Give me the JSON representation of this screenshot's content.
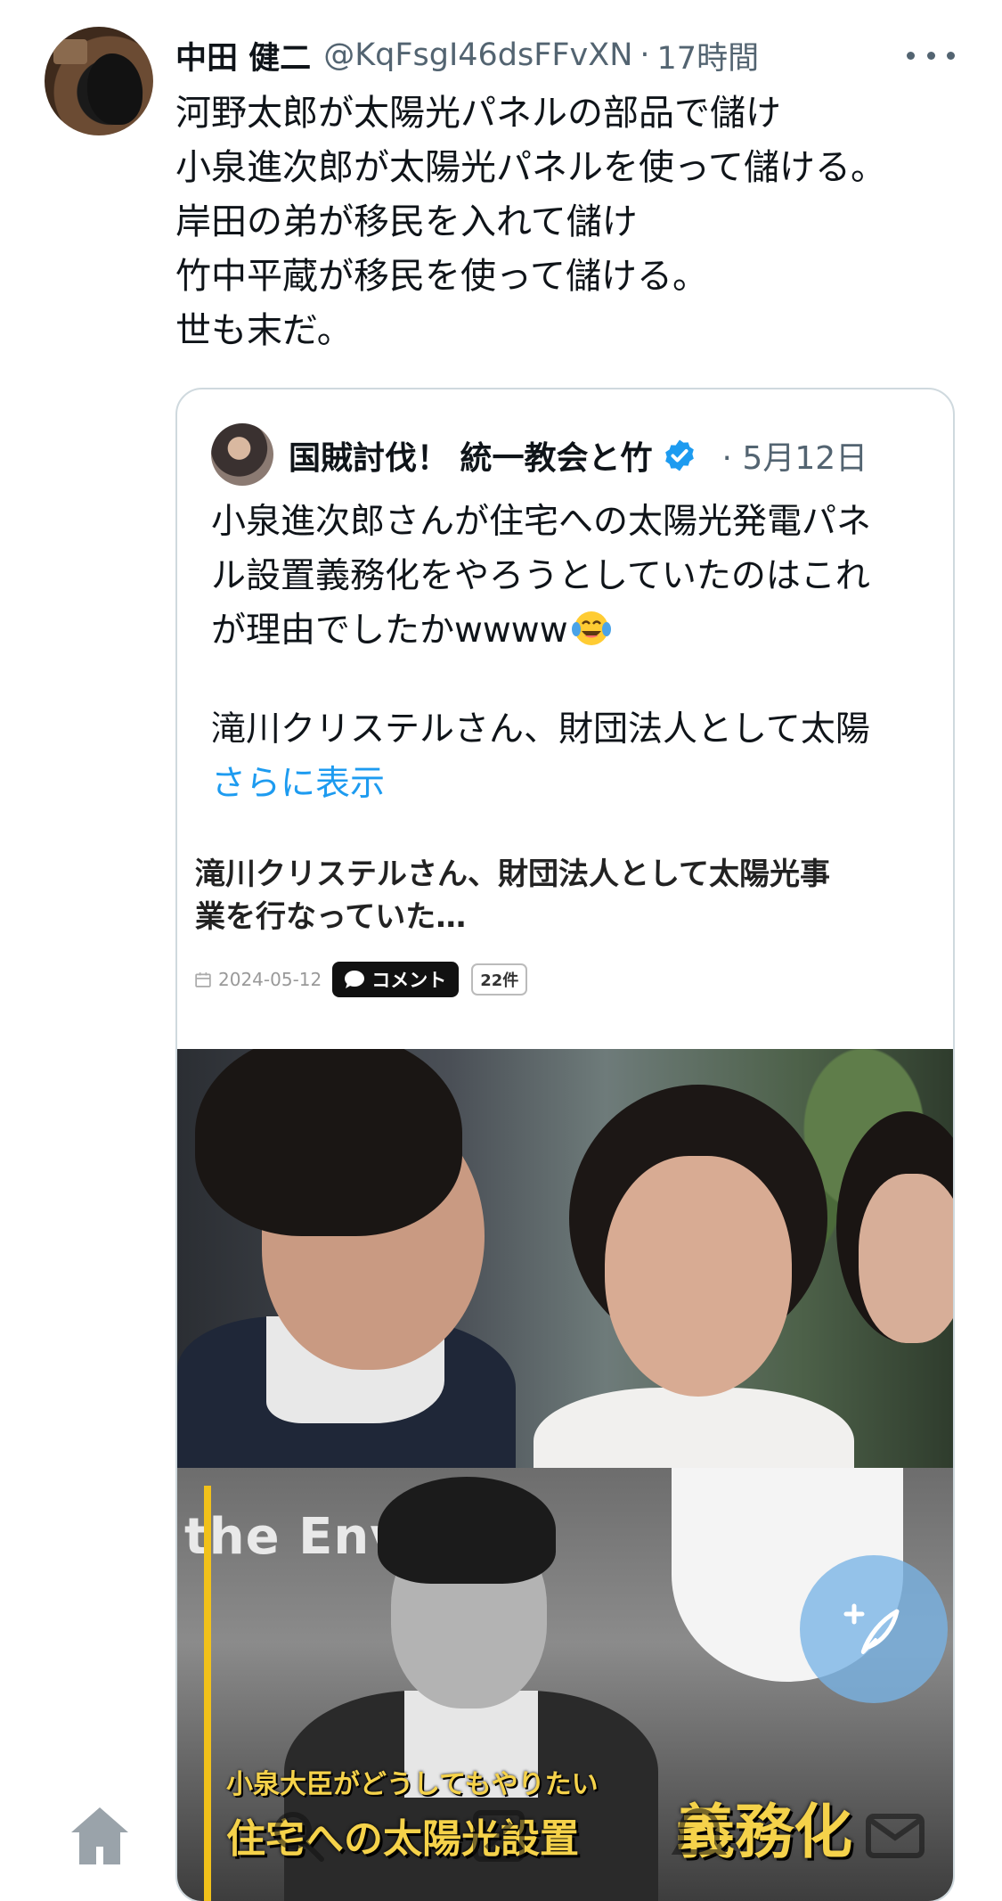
{
  "author": {
    "name": "中田 健二",
    "handle": "@KqFsgI46dsFFvXN",
    "separator": "·",
    "time": "17時間"
  },
  "tweet_lines": [
    "河野太郎が太陽光パネルの部品で儲け",
    "小泉進次郎が太陽光パネルを使って儲ける。",
    "岸田の弟が移民を入れて儲け",
    "竹中平蔵が移民を使って儲ける。",
    "世も末だ。"
  ],
  "quote": {
    "name": "国賊討伐！ 統一教会と竹",
    "time": "· 5月12日",
    "text_lines": [
      "小泉進次郎さんが住宅への太陽光発電パネ",
      "ル設置義務化をやろうとしていたのはこれ",
      "が理由でしたかwwww"
    ],
    "text_line4": "滝川クリステルさん、財団法人として太陽",
    "show_more": "さらに表示",
    "article": {
      "title_lines": [
        "滝川クリステルさん、財団法人として太陽光事",
        "業を行なっていた…"
      ],
      "date": "2024-05-12",
      "comment_label": "コメント",
      "comment_count": "22件"
    },
    "image": {
      "bg_word": "the Env       ent",
      "caption_small": "小泉大臣がどうしてもやりたい",
      "caption_main": "住宅への太陽光設置",
      "caption_big": "義務化"
    }
  },
  "icons": {
    "more": "more-icon",
    "verified": "verified-icon",
    "emoji": "face-with-tears-of-joy-icon",
    "compose": "compose-icon",
    "nav": [
      "home-icon",
      "search-icon",
      "grok-icon",
      "notifications-icon",
      "messages-icon"
    ]
  },
  "colors": {
    "link": "#1d9bf0",
    "secondary_text": "#536471",
    "border": "#cfd9de",
    "caption_yellow": "#f5d24a"
  }
}
